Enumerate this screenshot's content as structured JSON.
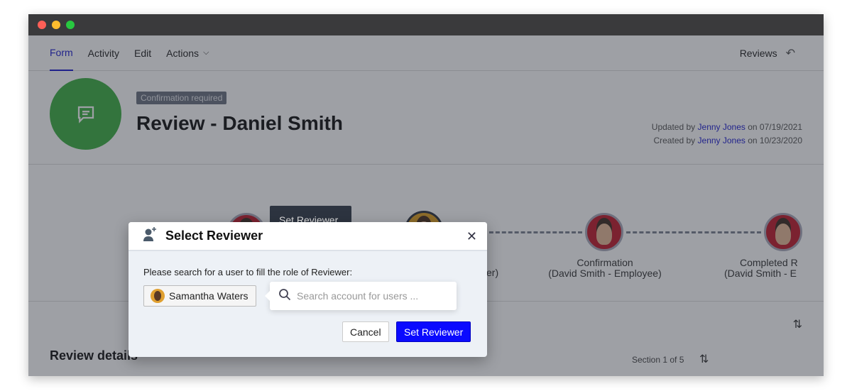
{
  "nav": {
    "tabs": [
      "Form",
      "Activity",
      "Edit",
      "Actions"
    ],
    "active": "Form",
    "right_label": "Reviews"
  },
  "header": {
    "badge": "Confirmation required",
    "title": "Review - Daniel Smith",
    "updated": {
      "prefix": "Updated by",
      "user": "Jenny Jones",
      "on": "on 07/19/2021"
    },
    "created": {
      "prefix": "Created by",
      "user": "Jenny Jones",
      "on": "on 10/23/2020"
    }
  },
  "flow": {
    "nodes": [
      {
        "label": "",
        "sub": ""
      },
      {
        "label": "",
        "sub": "er)"
      },
      {
        "label": "Confirmation",
        "sub": "(David Smith - Employee)"
      },
      {
        "label": "Completed R",
        "sub": "(David Smith - E"
      }
    ]
  },
  "tooltip": "Set Reviewer",
  "lower": {
    "title": "Review details",
    "section": "Section 1 of 5"
  },
  "modal": {
    "title": "Select Reviewer",
    "prompt": "Please search for a user to fill the role of Reviewer:",
    "selected_user": "Samantha Waters",
    "search_placeholder": "Search account for users ...",
    "cancel": "Cancel",
    "confirm": "Set Reviewer"
  },
  "colors": {
    "accent": "#1a1ad0",
    "primary_button": "#0a0aff",
    "status_icon": "#3cb043"
  }
}
